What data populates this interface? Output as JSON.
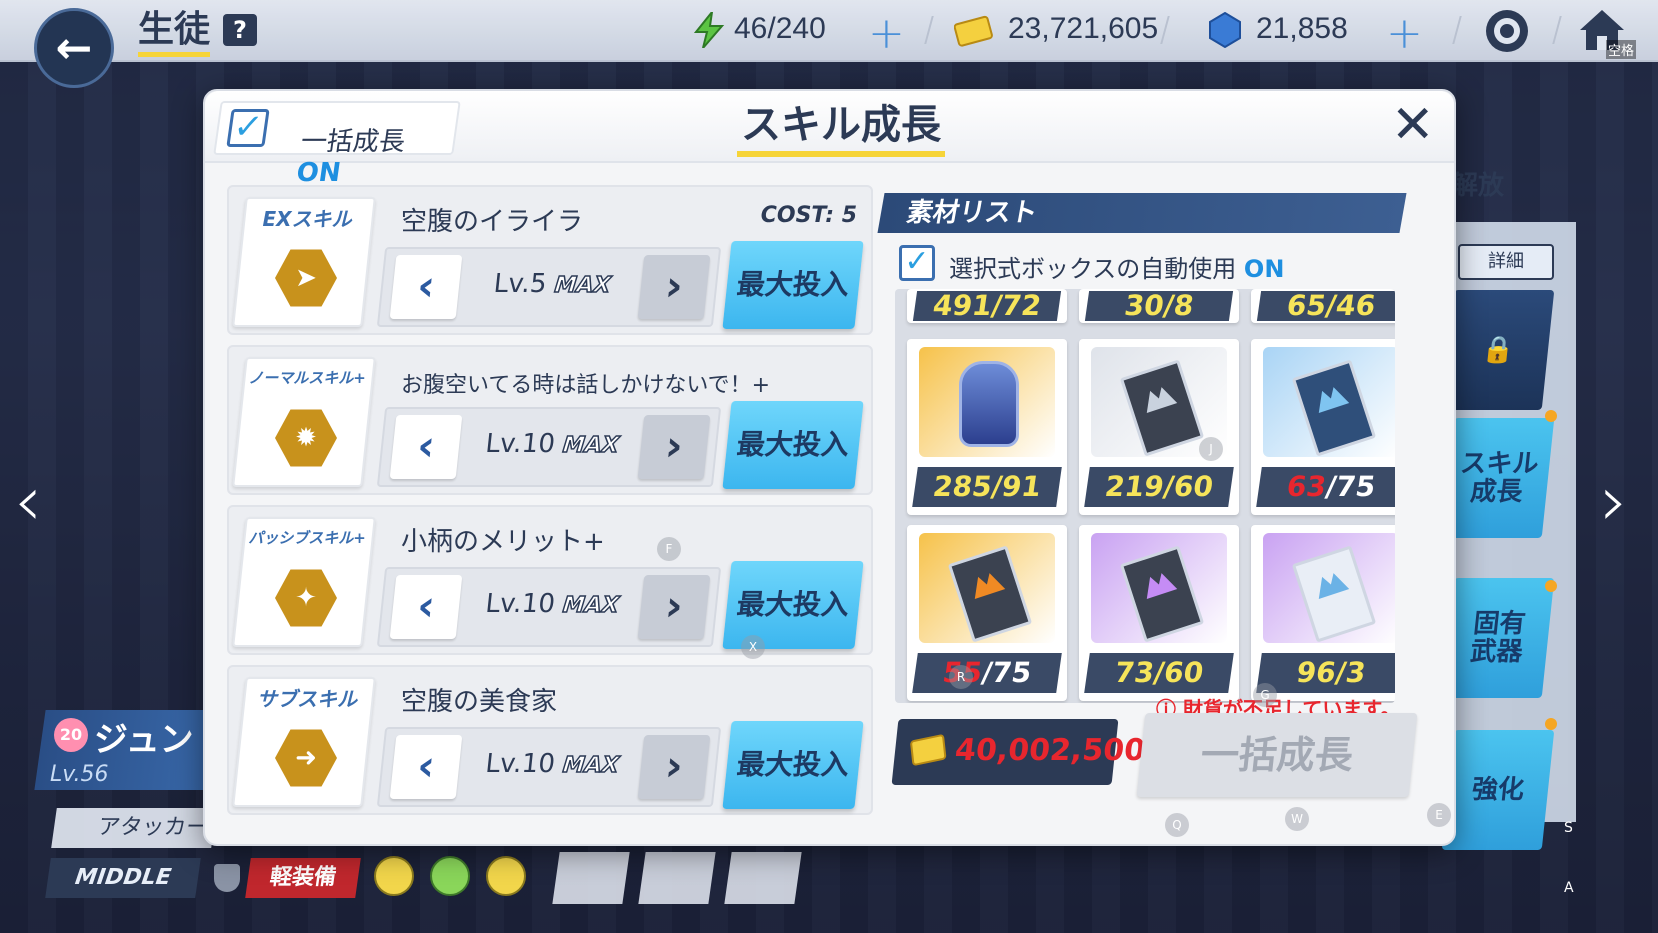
{
  "topbar": {
    "title": "生徒",
    "help": "?",
    "ap": "46/240",
    "credits": "23,721,605",
    "gems": "21,858",
    "home_label": "空格"
  },
  "side": {
    "release_label": "解放",
    "detail_label": "詳細",
    "unlock_label": "能力\n解放",
    "skill_label": "スキル\n成長",
    "weapon_label": "固有\n武器",
    "enhance_label": "強化"
  },
  "character": {
    "heart_level": "20",
    "name": "ジュン",
    "level": "Lv.56",
    "role": "アタッカー",
    "position": "MIDDLE",
    "armor": "軽装備"
  },
  "dialog": {
    "bulk_toggle_label": "一括成長",
    "bulk_toggle_state": "ON",
    "title": "スキル成長",
    "close": "✕",
    "skills": [
      {
        "type": "EXスキル",
        "name": "空腹のイライラ",
        "cost": "COST: 5",
        "level": "Lv.5",
        "max": "MAX",
        "button": "最大投入",
        "icon": "ex-skill-icon"
      },
      {
        "type": "ノーマルスキル+",
        "name": "お腹空いてる時は話しかけないで！+",
        "level": "Lv.10",
        "max": "MAX",
        "button": "最大投入",
        "icon": "normal-skill-icon"
      },
      {
        "type": "パッシブスキル+",
        "name": "小柄のメリット+",
        "level": "Lv.10",
        "max": "MAX",
        "button": "最大投入",
        "icon": "passive-skill-icon"
      },
      {
        "type": "サブスキル",
        "name": "空腹の美食家",
        "level": "Lv.10",
        "max": "MAX",
        "button": "最大投入",
        "icon": "sub-skill-icon"
      }
    ],
    "materials_header": "素材リスト",
    "auto_use_label": "選択式ボックスの自動使用",
    "auto_use_state": "ON",
    "materials_top": [
      "491/72",
      "30/8",
      "65/46"
    ],
    "materials": [
      {
        "short": "",
        "rest": "285/91",
        "icon": "helmet-icon",
        "bg": "#f6c24a"
      },
      {
        "short": "",
        "rest": "219/60",
        "icon": "gray-book-icon",
        "bg": "#dfe3ea"
      },
      {
        "short": "63",
        "rest": "/75",
        "icon": "blue-book-icon",
        "bg": "#a9d4f5"
      },
      {
        "short": "55",
        "rest": "/75",
        "icon": "gold-book-icon",
        "bg": "#f6c24a"
      },
      {
        "short": "",
        "rest": "73/60",
        "icon": "purple-book-icon",
        "bg": "#c9a2f2"
      },
      {
        "short": "",
        "rest": "96/3",
        "icon": "tech-note-icon",
        "bg": "#c9a2f2"
      }
    ],
    "cost_value": "40,002,500",
    "warning": "ⓘ 財貨が不足しています。",
    "bulk_button": "一括成長"
  },
  "keys": [
    "F",
    "X",
    "J",
    "R",
    "G",
    "Q",
    "W",
    "E",
    "S",
    "A"
  ]
}
